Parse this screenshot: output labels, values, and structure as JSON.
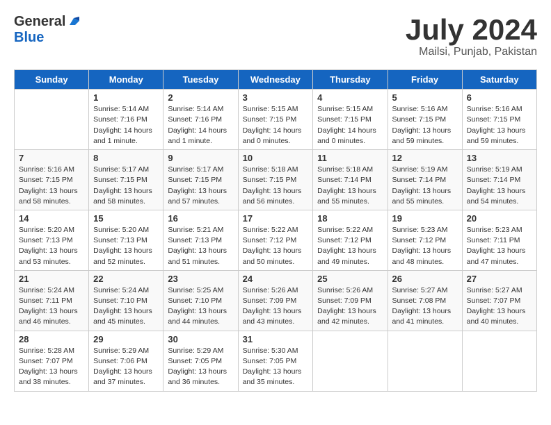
{
  "header": {
    "logo_general": "General",
    "logo_blue": "Blue",
    "month": "July 2024",
    "location": "Mailsi, Punjab, Pakistan"
  },
  "weekdays": [
    "Sunday",
    "Monday",
    "Tuesday",
    "Wednesday",
    "Thursday",
    "Friday",
    "Saturday"
  ],
  "weeks": [
    [
      {
        "day": "",
        "info": ""
      },
      {
        "day": "1",
        "info": "Sunrise: 5:14 AM\nSunset: 7:16 PM\nDaylight: 14 hours\nand 1 minute."
      },
      {
        "day": "2",
        "info": "Sunrise: 5:14 AM\nSunset: 7:16 PM\nDaylight: 14 hours\nand 1 minute."
      },
      {
        "day": "3",
        "info": "Sunrise: 5:15 AM\nSunset: 7:15 PM\nDaylight: 14 hours\nand 0 minutes."
      },
      {
        "day": "4",
        "info": "Sunrise: 5:15 AM\nSunset: 7:15 PM\nDaylight: 14 hours\nand 0 minutes."
      },
      {
        "day": "5",
        "info": "Sunrise: 5:16 AM\nSunset: 7:15 PM\nDaylight: 13 hours\nand 59 minutes."
      },
      {
        "day": "6",
        "info": "Sunrise: 5:16 AM\nSunset: 7:15 PM\nDaylight: 13 hours\nand 59 minutes."
      }
    ],
    [
      {
        "day": "7",
        "info": "Sunrise: 5:16 AM\nSunset: 7:15 PM\nDaylight: 13 hours\nand 58 minutes."
      },
      {
        "day": "8",
        "info": "Sunrise: 5:17 AM\nSunset: 7:15 PM\nDaylight: 13 hours\nand 58 minutes."
      },
      {
        "day": "9",
        "info": "Sunrise: 5:17 AM\nSunset: 7:15 PM\nDaylight: 13 hours\nand 57 minutes."
      },
      {
        "day": "10",
        "info": "Sunrise: 5:18 AM\nSunset: 7:15 PM\nDaylight: 13 hours\nand 56 minutes."
      },
      {
        "day": "11",
        "info": "Sunrise: 5:18 AM\nSunset: 7:14 PM\nDaylight: 13 hours\nand 55 minutes."
      },
      {
        "day": "12",
        "info": "Sunrise: 5:19 AM\nSunset: 7:14 PM\nDaylight: 13 hours\nand 55 minutes."
      },
      {
        "day": "13",
        "info": "Sunrise: 5:19 AM\nSunset: 7:14 PM\nDaylight: 13 hours\nand 54 minutes."
      }
    ],
    [
      {
        "day": "14",
        "info": "Sunrise: 5:20 AM\nSunset: 7:13 PM\nDaylight: 13 hours\nand 53 minutes."
      },
      {
        "day": "15",
        "info": "Sunrise: 5:20 AM\nSunset: 7:13 PM\nDaylight: 13 hours\nand 52 minutes."
      },
      {
        "day": "16",
        "info": "Sunrise: 5:21 AM\nSunset: 7:13 PM\nDaylight: 13 hours\nand 51 minutes."
      },
      {
        "day": "17",
        "info": "Sunrise: 5:22 AM\nSunset: 7:12 PM\nDaylight: 13 hours\nand 50 minutes."
      },
      {
        "day": "18",
        "info": "Sunrise: 5:22 AM\nSunset: 7:12 PM\nDaylight: 13 hours\nand 49 minutes."
      },
      {
        "day": "19",
        "info": "Sunrise: 5:23 AM\nSunset: 7:12 PM\nDaylight: 13 hours\nand 48 minutes."
      },
      {
        "day": "20",
        "info": "Sunrise: 5:23 AM\nSunset: 7:11 PM\nDaylight: 13 hours\nand 47 minutes."
      }
    ],
    [
      {
        "day": "21",
        "info": "Sunrise: 5:24 AM\nSunset: 7:11 PM\nDaylight: 13 hours\nand 46 minutes."
      },
      {
        "day": "22",
        "info": "Sunrise: 5:24 AM\nSunset: 7:10 PM\nDaylight: 13 hours\nand 45 minutes."
      },
      {
        "day": "23",
        "info": "Sunrise: 5:25 AM\nSunset: 7:10 PM\nDaylight: 13 hours\nand 44 minutes."
      },
      {
        "day": "24",
        "info": "Sunrise: 5:26 AM\nSunset: 7:09 PM\nDaylight: 13 hours\nand 43 minutes."
      },
      {
        "day": "25",
        "info": "Sunrise: 5:26 AM\nSunset: 7:09 PM\nDaylight: 13 hours\nand 42 minutes."
      },
      {
        "day": "26",
        "info": "Sunrise: 5:27 AM\nSunset: 7:08 PM\nDaylight: 13 hours\nand 41 minutes."
      },
      {
        "day": "27",
        "info": "Sunrise: 5:27 AM\nSunset: 7:07 PM\nDaylight: 13 hours\nand 40 minutes."
      }
    ],
    [
      {
        "day": "28",
        "info": "Sunrise: 5:28 AM\nSunset: 7:07 PM\nDaylight: 13 hours\nand 38 minutes."
      },
      {
        "day": "29",
        "info": "Sunrise: 5:29 AM\nSunset: 7:06 PM\nDaylight: 13 hours\nand 37 minutes."
      },
      {
        "day": "30",
        "info": "Sunrise: 5:29 AM\nSunset: 7:05 PM\nDaylight: 13 hours\nand 36 minutes."
      },
      {
        "day": "31",
        "info": "Sunrise: 5:30 AM\nSunset: 7:05 PM\nDaylight: 13 hours\nand 35 minutes."
      },
      {
        "day": "",
        "info": ""
      },
      {
        "day": "",
        "info": ""
      },
      {
        "day": "",
        "info": ""
      }
    ]
  ]
}
